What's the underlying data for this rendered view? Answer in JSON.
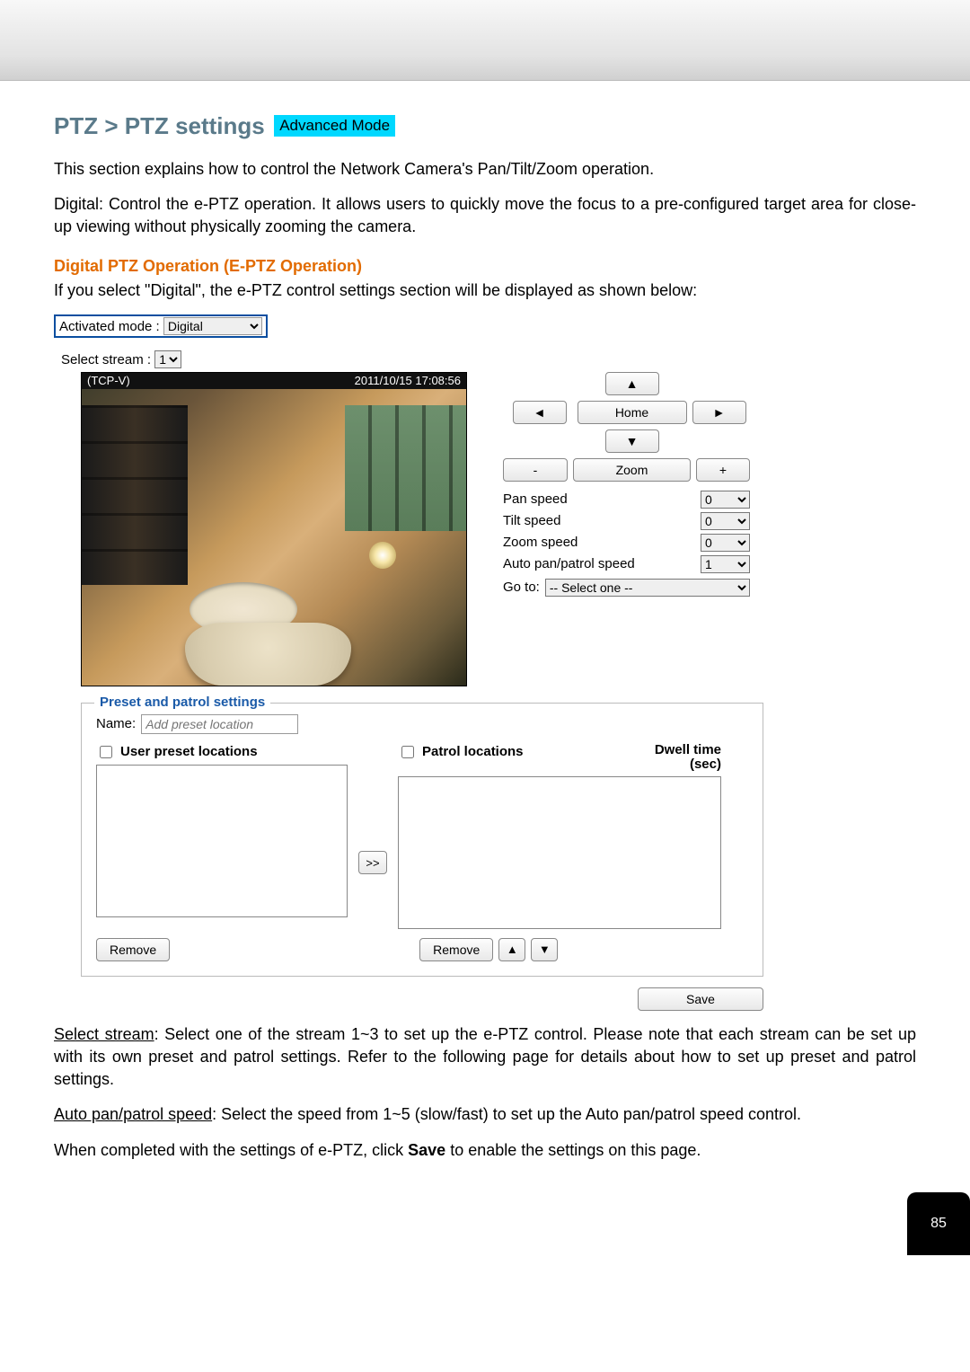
{
  "header": {
    "title": "PTZ > PTZ settings",
    "badge": "Advanced Mode"
  },
  "intro": {
    "p1": "This section explains how to control the Network Camera's Pan/Tilt/Zoom operation.",
    "p2": "Digital: Control the e-PTZ operation. It allows users to quickly move the focus to a pre-configured target area for close-up viewing without physically zooming the camera."
  },
  "section": {
    "subhead": "Digital PTZ Operation (E-PTZ Operation)",
    "desc": "If you select \"Digital\", the e-PTZ control settings section will be displayed as shown below:"
  },
  "mode": {
    "label": "Activated mode :",
    "value": "Digital"
  },
  "stream": {
    "label": "Select stream :",
    "value": "1"
  },
  "preview": {
    "title": "(TCP-V)",
    "timestamp": "2011/10/15  17:08:56"
  },
  "ptz": {
    "up": "▲",
    "down": "▼",
    "left": "◄",
    "right": "►",
    "home": "Home",
    "zoomLabel": "Zoom",
    "zoomOut": "-",
    "zoomIn": "+",
    "speeds": {
      "pan": {
        "label": "Pan speed",
        "value": "0"
      },
      "tilt": {
        "label": "Tilt speed",
        "value": "0"
      },
      "zoom": {
        "label": "Zoom speed",
        "value": "0"
      },
      "auto": {
        "label": "Auto pan/patrol speed",
        "value": "1"
      }
    },
    "goto": {
      "label": "Go to:",
      "value": "-- Select one --"
    }
  },
  "preset": {
    "legend": "Preset and patrol settings",
    "nameLabel": "Name:",
    "namePlaceholder": "Add preset location",
    "userHeader": "User preset locations",
    "patrolHeader": "Patrol locations",
    "dwellHeader1": "Dwell time",
    "dwellHeader2": "(sec)",
    "moveBtn": ">>",
    "removeBtn": "Remove",
    "upBtn": "▲",
    "downBtn": "▼"
  },
  "save": {
    "label": "Save"
  },
  "footer": {
    "p1a": "Select stream",
    "p1b": ": Select one of the stream 1~3 to set up the e-PTZ control. Please note that each stream can be set up with its own preset and patrol settings. Refer to the following page for details about how to set up preset and patrol settings.",
    "p2a": "Auto pan/patrol speed",
    "p2b": ": Select the speed from 1~5 (slow/fast) to set up the Auto pan/patrol speed control.",
    "p3a": "When completed with the settings of e-PTZ, click ",
    "p3b": "Save",
    "p3c": " to enable the settings on this page."
  },
  "pageNumber": "85"
}
